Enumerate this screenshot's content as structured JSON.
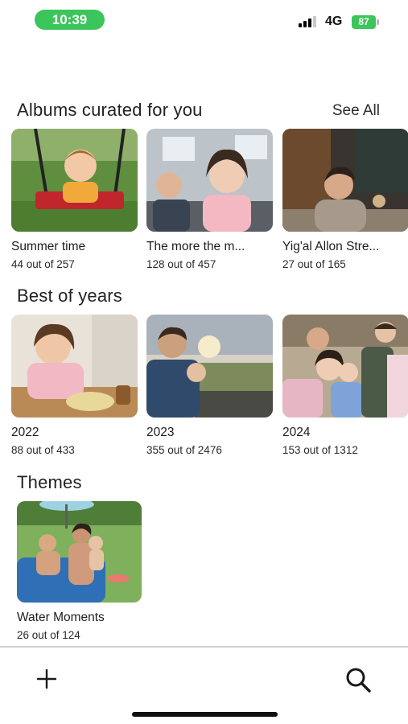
{
  "status_bar": {
    "time": "10:39",
    "network": "4G",
    "battery": "87"
  },
  "curated": {
    "title": "Albums curated for you",
    "see_all": "See All",
    "albums": [
      {
        "title": "Summer time",
        "count": "44 out of 257"
      },
      {
        "title": "The more the m...",
        "count": "128 out of 457"
      },
      {
        "title": "Yig'al Allon Stre...",
        "count": "27 out of 165"
      }
    ]
  },
  "best_of_years": {
    "title": "Best of years",
    "albums": [
      {
        "title": "2022",
        "count": "88 out of 433"
      },
      {
        "title": "2023",
        "count": "355 out of 2476"
      },
      {
        "title": "2024",
        "count": "153 out of 1312"
      }
    ]
  },
  "themes": {
    "title": "Themes",
    "albums": [
      {
        "title": "Water Moments",
        "count": "26 out of 124"
      }
    ]
  },
  "bottom_bar": {
    "add_icon": "plus-icon",
    "search_icon": "search-icon"
  },
  "colors": {
    "status_green": "#3cc55a",
    "text": "#1c1c1e",
    "divider": "#cfcfcf"
  }
}
